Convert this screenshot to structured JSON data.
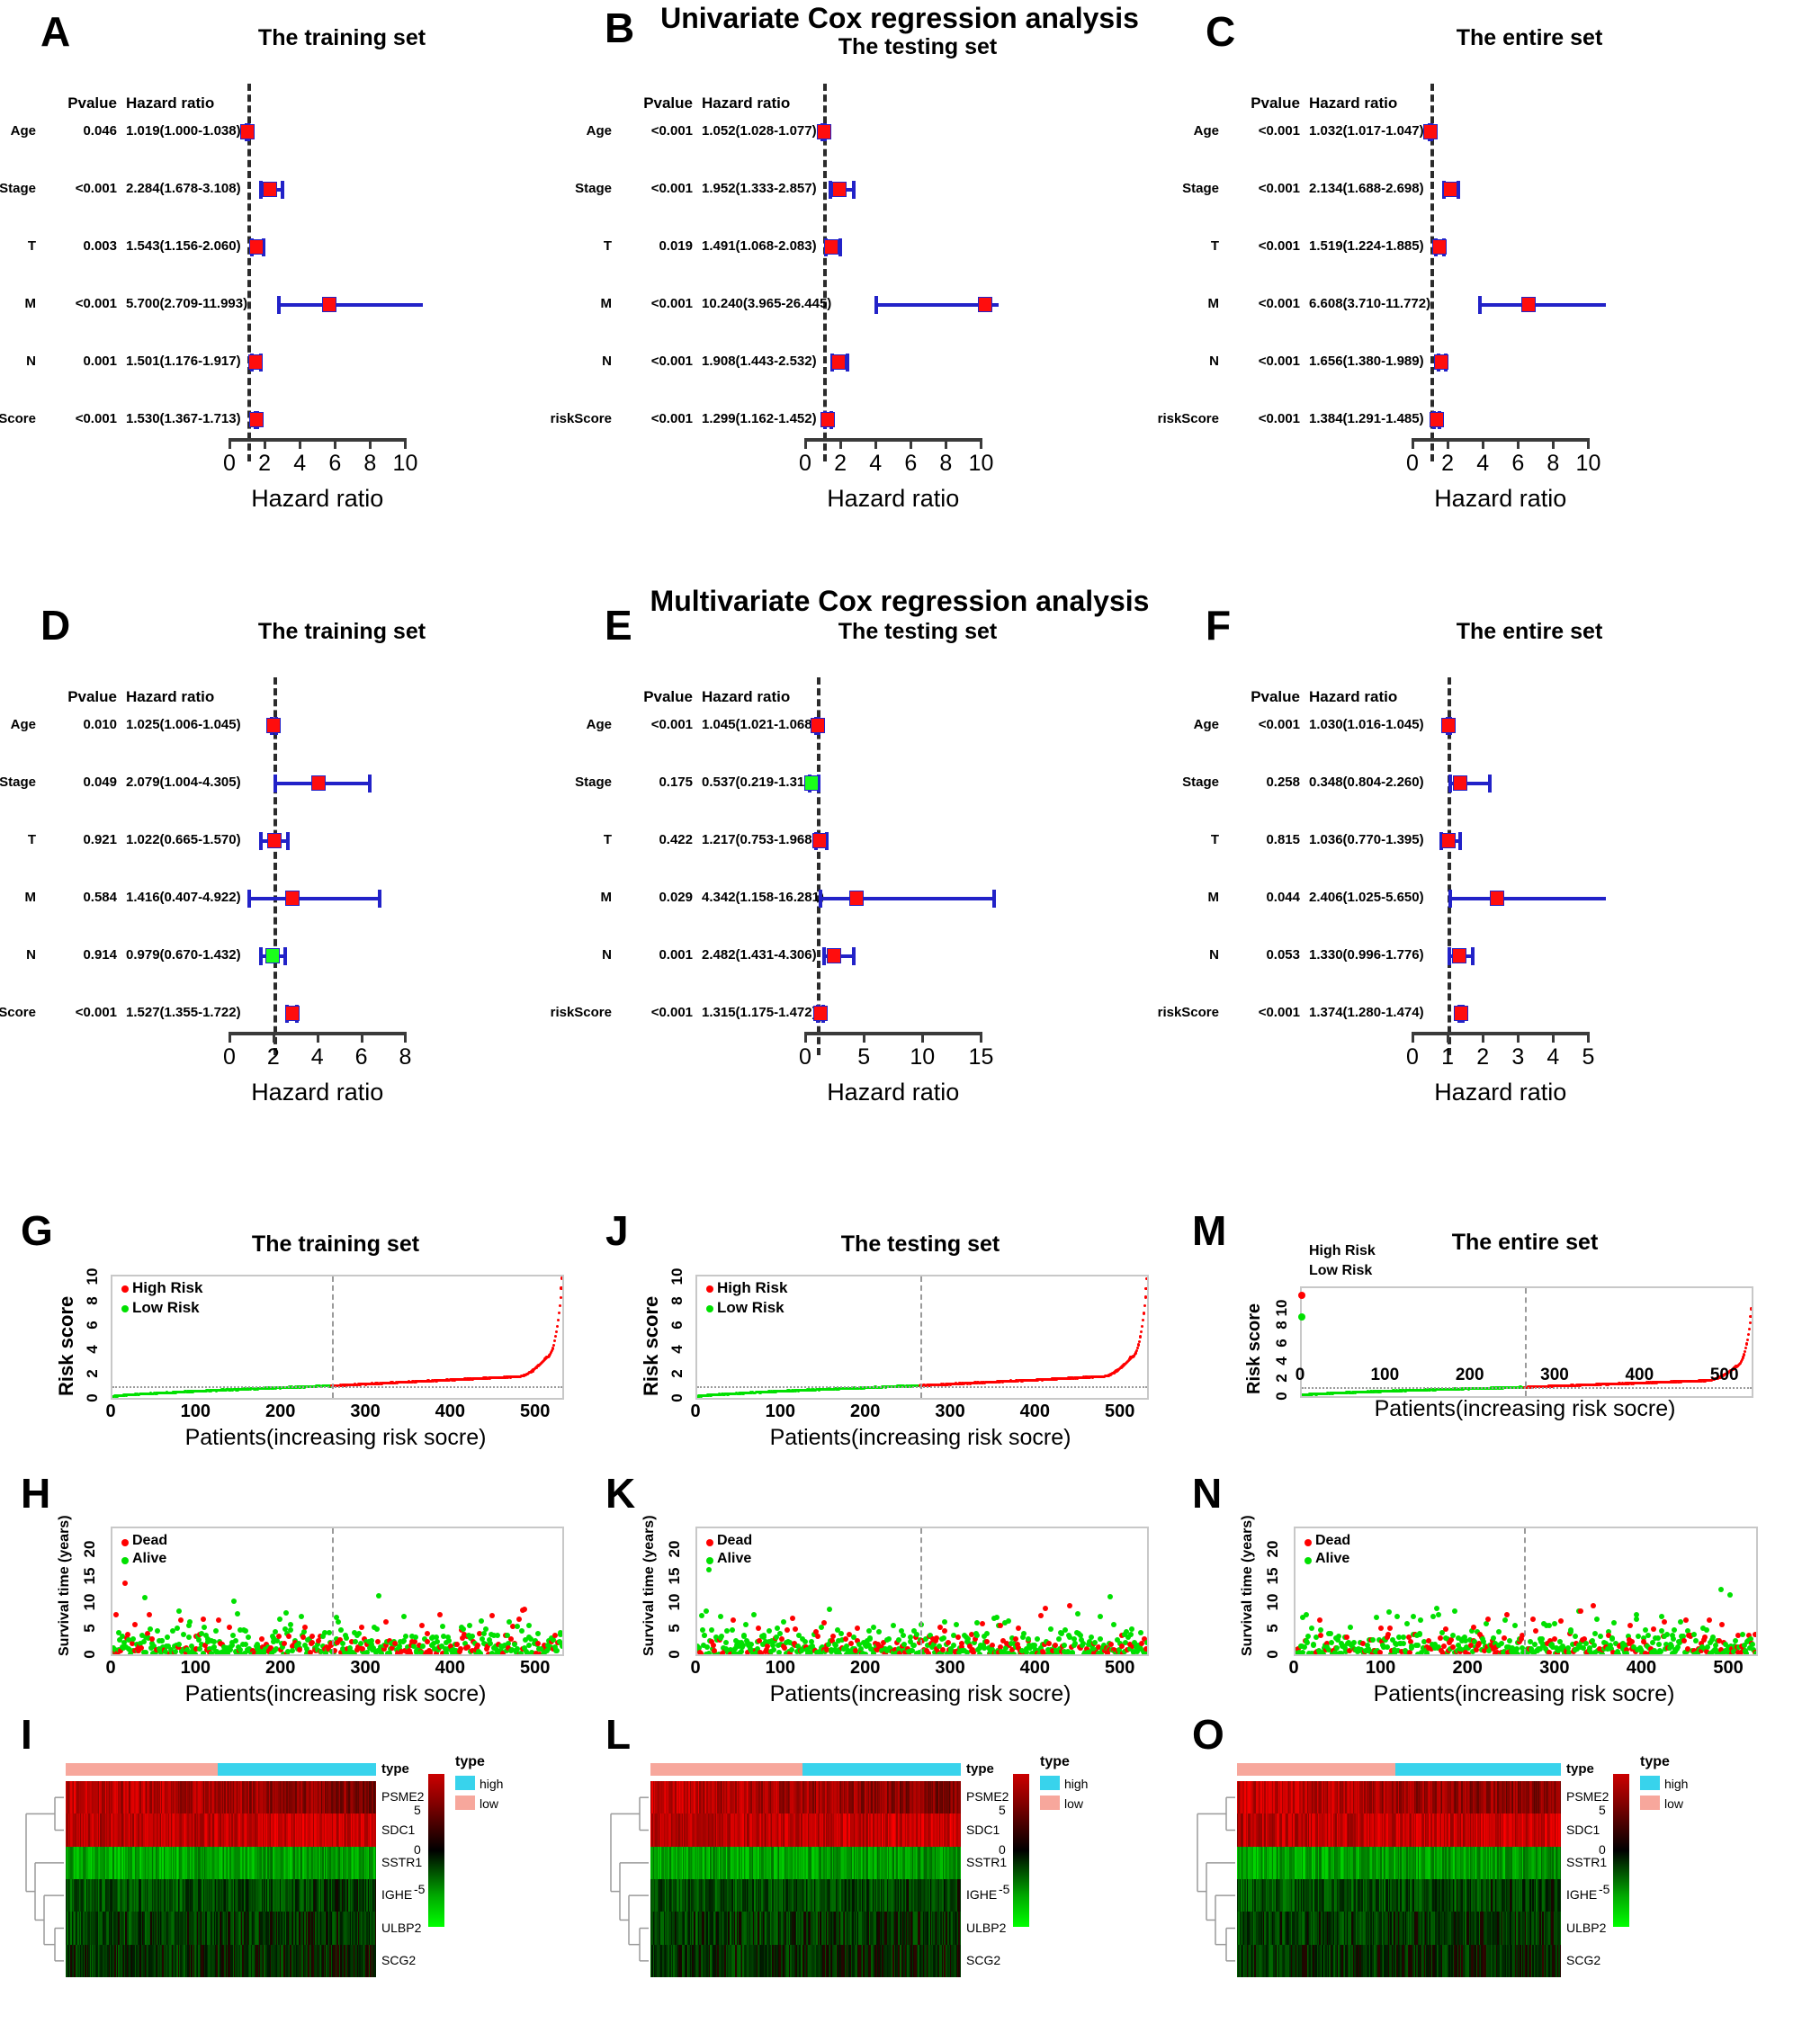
{
  "figure": {
    "section_titles": {
      "univariate": "Univariate Cox regression analysis",
      "multivariate": "Multivariate Cox regression analysis"
    },
    "axis_name": "Hazard ratio",
    "headers": {
      "pvalue": "Pvalue",
      "hazard_ratio": "Hazard ratio"
    }
  },
  "chart_data": [
    {
      "id": "A",
      "type": "forest",
      "letter": "A",
      "title": "The training set",
      "analysis": "Univariate Cox regression analysis",
      "xlabel": "Hazard ratio",
      "xlim": [
        0,
        11
      ],
      "xticks": [
        0,
        2,
        4,
        6,
        8,
        10
      ],
      "refline": 1,
      "columns": [
        "Pvalue",
        "Hazard ratio"
      ],
      "rows": [
        {
          "variable": "Age",
          "pvalue": "0.046",
          "hr_text": "1.019(1.000-1.038)",
          "hr": 1.019,
          "lo": 1.0,
          "hi": 1.038,
          "color": "red"
        },
        {
          "variable": "Stage",
          "pvalue": "<0.001",
          "hr_text": "2.284(1.678-3.108)",
          "hr": 2.284,
          "lo": 1.678,
          "hi": 3.108,
          "color": "red"
        },
        {
          "variable": "T",
          "pvalue": "0.003",
          "hr_text": "1.543(1.156-2.060)",
          "hr": 1.543,
          "lo": 1.156,
          "hi": 2.06,
          "color": "red"
        },
        {
          "variable": "M",
          "pvalue": "<0.001",
          "hr_text": "5.700(2.709-11.993)",
          "hr": 5.7,
          "lo": 2.709,
          "hi": 11.993,
          "color": "red"
        },
        {
          "variable": "N",
          "pvalue": "0.001",
          "hr_text": "1.501(1.176-1.917)",
          "hr": 1.501,
          "lo": 1.176,
          "hi": 1.917,
          "color": "red"
        },
        {
          "variable": "riskScore",
          "pvalue": "<0.001",
          "hr_text": "1.530(1.367-1.713)",
          "hr": 1.53,
          "lo": 1.367,
          "hi": 1.713,
          "color": "red"
        }
      ]
    },
    {
      "id": "B",
      "type": "forest",
      "letter": "B",
      "title": "The testing set",
      "analysis": "Univariate Cox regression analysis",
      "xlabel": "Hazard ratio",
      "xlim": [
        0,
        11
      ],
      "xticks": [
        0,
        2,
        4,
        6,
        8,
        10
      ],
      "refline": 1,
      "columns": [
        "Pvalue",
        "Hazard ratio"
      ],
      "rows": [
        {
          "variable": "Age",
          "pvalue": "<0.001",
          "hr_text": "1.052(1.028-1.077)",
          "hr": 1.052,
          "lo": 1.028,
          "hi": 1.077,
          "color": "red"
        },
        {
          "variable": "Stage",
          "pvalue": "<0.001",
          "hr_text": "1.952(1.333-2.857)",
          "hr": 1.952,
          "lo": 1.333,
          "hi": 2.857,
          "color": "red"
        },
        {
          "variable": "T",
          "pvalue": "0.019",
          "hr_text": "1.491(1.068-2.083)",
          "hr": 1.491,
          "lo": 1.068,
          "hi": 2.083,
          "color": "red"
        },
        {
          "variable": "M",
          "pvalue": "<0.001",
          "hr_text": "10.240(3.965-26.445)",
          "hr": 10.24,
          "lo": 3.965,
          "hi": 26.445,
          "color": "red"
        },
        {
          "variable": "N",
          "pvalue": "<0.001",
          "hr_text": "1.908(1.443-2.532)",
          "hr": 1.908,
          "lo": 1.443,
          "hi": 2.532,
          "color": "red"
        },
        {
          "variable": "riskScore",
          "pvalue": "<0.001",
          "hr_text": "1.299(1.162-1.452)",
          "hr": 1.299,
          "lo": 1.162,
          "hi": 1.452,
          "color": "red"
        }
      ]
    },
    {
      "id": "C",
      "type": "forest",
      "letter": "C",
      "title": "The entire set",
      "analysis": "Univariate Cox regression analysis",
      "xlabel": "Hazard ratio",
      "xlim": [
        0,
        11
      ],
      "xticks": [
        0,
        2,
        4,
        6,
        8,
        10
      ],
      "refline": 1,
      "columns": [
        "Pvalue",
        "Hazard ratio"
      ],
      "rows": [
        {
          "variable": "Age",
          "pvalue": "<0.001",
          "hr_text": "1.032(1.017-1.047)",
          "hr": 1.032,
          "lo": 1.017,
          "hi": 1.047,
          "color": "red"
        },
        {
          "variable": "Stage",
          "pvalue": "<0.001",
          "hr_text": "2.134(1.688-2.698)",
          "hr": 2.134,
          "lo": 1.688,
          "hi": 2.698,
          "color": "red"
        },
        {
          "variable": "T",
          "pvalue": "<0.001",
          "hr_text": "1.519(1.224-1.885)",
          "hr": 1.519,
          "lo": 1.224,
          "hi": 1.885,
          "color": "red"
        },
        {
          "variable": "M",
          "pvalue": "<0.001",
          "hr_text": "6.608(3.710-11.772)",
          "hr": 6.608,
          "lo": 3.71,
          "hi": 11.772,
          "color": "red"
        },
        {
          "variable": "N",
          "pvalue": "<0.001",
          "hr_text": "1.656(1.380-1.989)",
          "hr": 1.656,
          "lo": 1.38,
          "hi": 1.989,
          "color": "red"
        },
        {
          "variable": "riskScore",
          "pvalue": "<0.001",
          "hr_text": "1.384(1.291-1.485)",
          "hr": 1.384,
          "lo": 1.291,
          "hi": 1.485,
          "color": "red"
        }
      ]
    },
    {
      "id": "D",
      "type": "forest",
      "letter": "D",
      "title": "The training set",
      "analysis": "Multivariate Cox regression analysis",
      "xlabel": "Hazard ratio",
      "xlim": [
        0,
        8.8
      ],
      "xticks": [
        0,
        2,
        4,
        6,
        8
      ],
      "refline": 2,
      "columns": [
        "Pvalue",
        "Hazard ratio"
      ],
      "rows": [
        {
          "variable": "Age",
          "pvalue": "0.010",
          "hr_text": "1.025(1.006-1.045)",
          "hr": 2.02,
          "lo": 1.98,
          "hi": 2.07,
          "color": "red"
        },
        {
          "variable": "Stage",
          "pvalue": "0.049",
          "hr_text": "2.079(1.004-4.305)",
          "hr": 4.05,
          "lo": 2.0,
          "hi": 6.45,
          "color": "red"
        },
        {
          "variable": "T",
          "pvalue": "0.921",
          "hr_text": "1.022(0.665-1.570)",
          "hr": 2.05,
          "lo": 1.35,
          "hi": 2.75,
          "color": "red"
        },
        {
          "variable": "M",
          "pvalue": "0.584",
          "hr_text": "1.416(0.407-4.922)",
          "hr": 2.85,
          "lo": 0.82,
          "hi": 6.9,
          "color": "red"
        },
        {
          "variable": "N",
          "pvalue": "0.914",
          "hr_text": "0.979(0.670-1.432)",
          "hr": 1.96,
          "lo": 1.35,
          "hi": 2.6,
          "color": "green"
        },
        {
          "variable": "riskScore",
          "pvalue": "<0.001",
          "hr_text": "1.527(1.355-1.722)",
          "hr": 2.85,
          "lo": 2.55,
          "hi": 3.15,
          "color": "red"
        }
      ]
    },
    {
      "id": "E",
      "type": "forest",
      "letter": "E",
      "title": "The testing set",
      "analysis": "Multivariate Cox regression analysis",
      "xlabel": "Hazard ratio",
      "xlim": [
        0,
        16.5
      ],
      "xticks": [
        0,
        5,
        10,
        15
      ],
      "refline": 1,
      "columns": [
        "Pvalue",
        "Hazard ratio"
      ],
      "rows": [
        {
          "variable": "Age",
          "pvalue": "<0.001",
          "hr_text": "1.045(1.021-1.068)",
          "hr": 1.045,
          "lo": 1.021,
          "hi": 1.068,
          "color": "red"
        },
        {
          "variable": "Stage",
          "pvalue": "0.175",
          "hr_text": "0.537(0.219-1.319)",
          "hr": 0.537,
          "lo": 0.219,
          "hi": 1.319,
          "color": "green"
        },
        {
          "variable": "T",
          "pvalue": "0.422",
          "hr_text": "1.217(0.753-1.968)",
          "hr": 1.217,
          "lo": 0.753,
          "hi": 1.968,
          "color": "red"
        },
        {
          "variable": "M",
          "pvalue": "0.029",
          "hr_text": "4.342(1.158-16.281)",
          "hr": 4.342,
          "lo": 1.158,
          "hi": 16.281,
          "color": "red"
        },
        {
          "variable": "N",
          "pvalue": "0.001",
          "hr_text": "2.482(1.431-4.306)",
          "hr": 2.482,
          "lo": 1.431,
          "hi": 4.306,
          "color": "red"
        },
        {
          "variable": "riskScore",
          "pvalue": "<0.001",
          "hr_text": "1.315(1.175-1.472)",
          "hr": 1.315,
          "lo": 1.175,
          "hi": 1.472,
          "color": "red"
        }
      ]
    },
    {
      "id": "F",
      "type": "forest",
      "letter": "F",
      "title": "The entire set",
      "analysis": "Multivariate Cox regression analysis",
      "xlabel": "Hazard ratio",
      "xlim": [
        0,
        5.5
      ],
      "xticks": [
        0,
        1,
        2,
        3,
        4,
        5
      ],
      "refline": 1,
      "columns": [
        "Pvalue",
        "Hazard ratio"
      ],
      "rows": [
        {
          "variable": "Age",
          "pvalue": "<0.001",
          "hr_text": "1.030(1.016-1.045)",
          "hr": 1.03,
          "lo": 1.016,
          "hi": 1.045,
          "color": "red"
        },
        {
          "variable": "Stage",
          "pvalue": "0.258",
          "hr_text": "0.348(0.804-2.260)",
          "hr": 1.35,
          "lo": 1.02,
          "hi": 2.26,
          "color": "red"
        },
        {
          "variable": "T",
          "pvalue": "0.815",
          "hr_text": "1.036(0.770-1.395)",
          "hr": 1.036,
          "lo": 0.77,
          "hi": 1.395,
          "color": "red"
        },
        {
          "variable": "M",
          "pvalue": "0.044",
          "hr_text": "2.406(1.025-5.650)",
          "hr": 2.406,
          "lo": 1.025,
          "hi": 5.65,
          "color": "red"
        },
        {
          "variable": "N",
          "pvalue": "0.053",
          "hr_text": "1.330(0.996-1.776)",
          "hr": 1.33,
          "lo": 0.996,
          "hi": 1.776,
          "color": "red"
        },
        {
          "variable": "riskScore",
          "pvalue": "<0.001",
          "hr_text": "1.374(1.280-1.474)",
          "hr": 1.374,
          "lo": 1.28,
          "hi": 1.474,
          "color": "red"
        }
      ]
    },
    {
      "id": "G",
      "type": "scatter",
      "letter": "G",
      "title": "The training set",
      "xlabel": "Patients(increasing risk socre)",
      "ylabel": "Risk score",
      "xticks": [
        0,
        100,
        200,
        300,
        400,
        500
      ],
      "yticks": [
        0,
        2,
        4,
        6,
        8,
        10
      ],
      "xlim": [
        0,
        530
      ],
      "ylim": [
        0,
        10
      ],
      "cutoff_x": 258,
      "cutoff_y": 1,
      "legend": [
        {
          "label": "High Risk",
          "color": "#ff0000"
        },
        {
          "label": "Low Risk",
          "color": "#00e000"
        }
      ],
      "n_points": 530
    },
    {
      "id": "J",
      "type": "scatter",
      "letter": "J",
      "title": "The testing set",
      "xlabel": "Patients(increasing risk socre)",
      "ylabel": "Risk score",
      "xticks": [
        0,
        100,
        200,
        300,
        400,
        500
      ],
      "yticks": [
        0,
        2,
        4,
        6,
        8,
        10
      ],
      "xlim": [
        0,
        530
      ],
      "ylim": [
        0,
        10
      ],
      "cutoff_x": 262,
      "cutoff_y": 1,
      "legend": [
        {
          "label": "High Risk",
          "color": "#ff0000"
        },
        {
          "label": "Low Risk",
          "color": "#00e000"
        }
      ],
      "n_points": 530
    },
    {
      "id": "M",
      "type": "scatter",
      "letter": "M",
      "title": "The entire set",
      "xlabel": "Patients(increasing risk socre)",
      "ylabel": "Risk score",
      "xticks": [
        0,
        100,
        200,
        300,
        400,
        500
      ],
      "yticks": [
        0,
        2,
        4,
        6,
        8,
        10
      ],
      "xlim": [
        0,
        530
      ],
      "ylim": [
        0,
        10
      ],
      "cutoff_x": 262,
      "cutoff_y": 1,
      "legend": [
        {
          "label": "High Risk",
          "color": "#ff0000"
        },
        {
          "label": "Low Risk",
          "color": "#00e000"
        }
      ],
      "n_points": 530
    },
    {
      "id": "H",
      "type": "scatter",
      "letter": "H",
      "title": "",
      "xlabel": "Patients(increasing risk socre)",
      "ylabel": "Survival time (years)",
      "xticks": [
        0,
        100,
        200,
        300,
        400,
        500
      ],
      "yticks": [
        0,
        5,
        10,
        15,
        20
      ],
      "xlim": [
        0,
        530
      ],
      "ylim": [
        0,
        24
      ],
      "cutoff_x": 258,
      "legend": [
        {
          "label": "Dead",
          "color": "#ff0000"
        },
        {
          "label": "Alive",
          "color": "#00e000"
        }
      ],
      "n_points": 530
    },
    {
      "id": "K",
      "type": "scatter",
      "letter": "K",
      "title": "",
      "xlabel": "Patients(increasing risk socre)",
      "ylabel": "Survival time (years)",
      "xticks": [
        0,
        100,
        200,
        300,
        400,
        500
      ],
      "yticks": [
        0,
        5,
        10,
        15,
        20
      ],
      "xlim": [
        0,
        530
      ],
      "ylim": [
        0,
        24
      ],
      "cutoff_x": 262,
      "legend": [
        {
          "label": "Dead",
          "color": "#ff0000"
        },
        {
          "label": "Alive",
          "color": "#00e000"
        }
      ],
      "n_points": 530
    },
    {
      "id": "N",
      "type": "scatter",
      "letter": "N",
      "title": "",
      "xlabel": "Patients(increasing risk socre)",
      "ylabel": "Survival time (years)",
      "xticks": [
        0,
        100,
        200,
        300,
        400,
        500
      ],
      "yticks": [
        0,
        5,
        10,
        15,
        20
      ],
      "xlim": [
        0,
        530
      ],
      "ylim": [
        0,
        24
      ],
      "cutoff_x": 262,
      "legend": [
        {
          "label": "Dead",
          "color": "#ff0000"
        },
        {
          "label": "Alive",
          "color": "#00e000"
        }
      ],
      "n_points": 530
    },
    {
      "id": "I",
      "type": "heatmap",
      "letter": "I",
      "genes": [
        "PSME2",
        "SDC1",
        "SSTR1",
        "IGHE",
        "ULBP2",
        "SCG2"
      ],
      "anno_label": "type",
      "legend_title": "type",
      "legend_items": [
        {
          "label": "high",
          "color": "#38d3ec"
        },
        {
          "label": "low",
          "color": "#f7a79c"
        }
      ],
      "scale_ticks": [
        "5",
        "0",
        "-5"
      ],
      "split_fraction": 0.49,
      "n_columns": 260
    },
    {
      "id": "L",
      "type": "heatmap",
      "letter": "L",
      "genes": [
        "PSME2",
        "SDC1",
        "SSTR1",
        "IGHE",
        "ULBP2",
        "SCG2"
      ],
      "anno_label": "type",
      "legend_title": "type",
      "legend_items": [
        {
          "label": "high",
          "color": "#38d3ec"
        },
        {
          "label": "low",
          "color": "#f7a79c"
        }
      ],
      "scale_ticks": [
        "5",
        "0",
        "-5"
      ],
      "split_fraction": 0.49,
      "n_columns": 260
    },
    {
      "id": "O",
      "type": "heatmap",
      "letter": "O",
      "genes": [
        "PSME2",
        "SDC1",
        "SSTR1",
        "IGHE",
        "ULBP2",
        "SCG2"
      ],
      "anno_label": "type",
      "legend_title": "type",
      "legend_items": [
        {
          "label": "high",
          "color": "#38d3ec"
        },
        {
          "label": "low",
          "color": "#f7a79c"
        }
      ],
      "scale_ticks": [
        "5",
        "0",
        "-5"
      ],
      "split_fraction": 0.49,
      "n_columns": 260
    }
  ]
}
